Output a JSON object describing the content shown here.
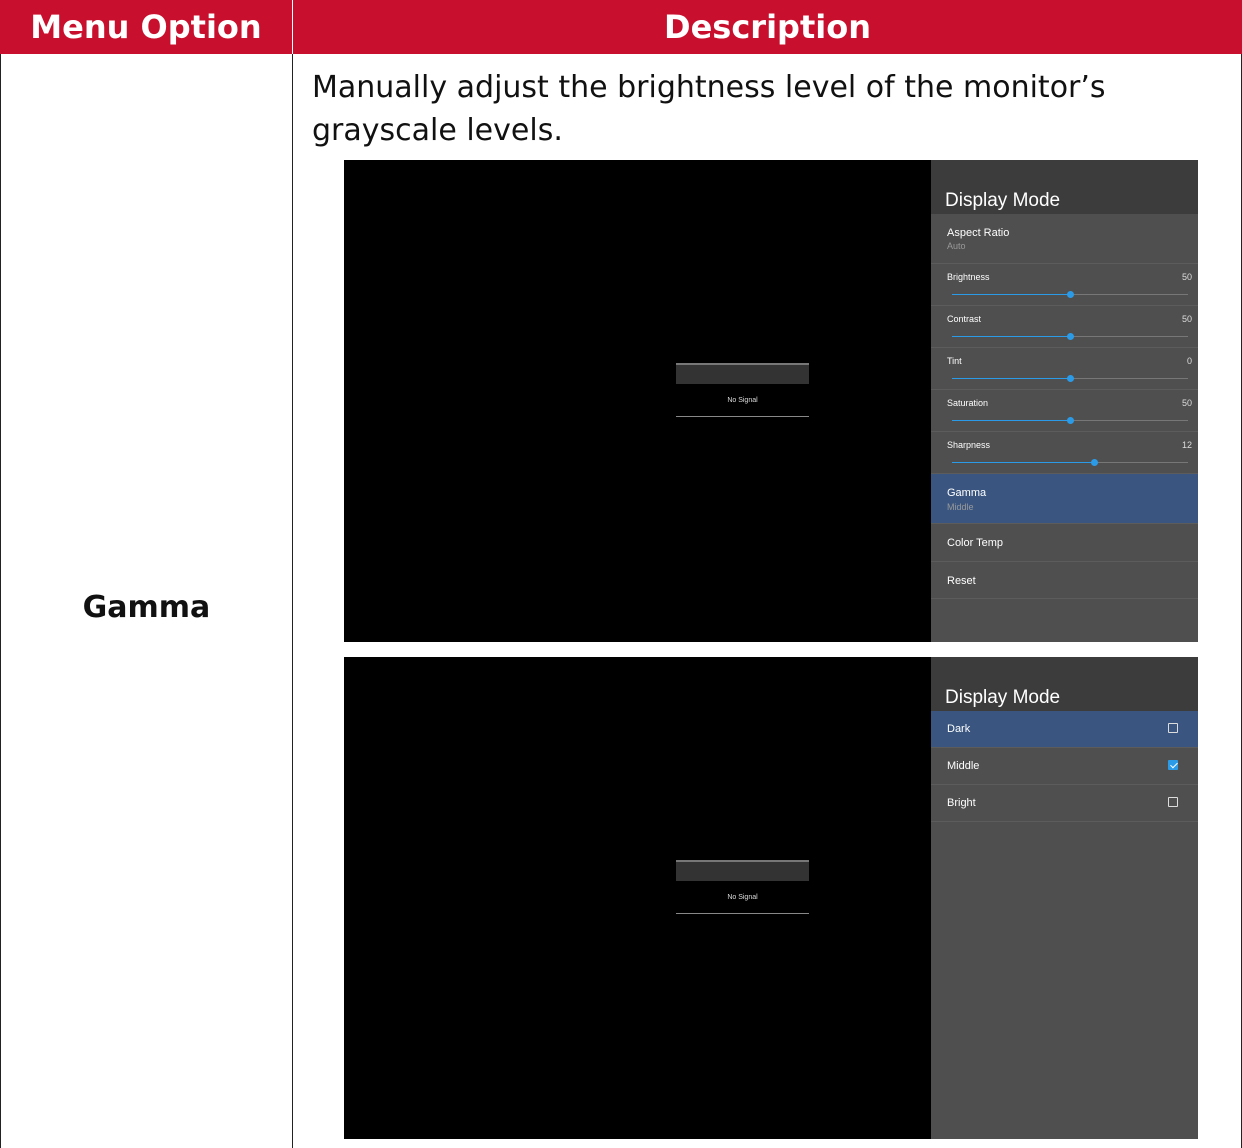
{
  "table": {
    "header": {
      "col1": "Menu Option",
      "col2": "Description"
    },
    "row": {
      "option": "Gamma",
      "description": "Manually adjust the brightness level of the monitor’s grayscale levels."
    }
  },
  "colors": {
    "header_bg": "#c8102e",
    "selected_bg": "#3a5680",
    "accent": "#2b9be8"
  },
  "screen1": {
    "no_signal": "No Signal",
    "panel_title": "Display Mode",
    "aspect_ratio": {
      "label": "Aspect Ratio",
      "value": "Auto"
    },
    "sliders": [
      {
        "label": "Brightness",
        "value": "50",
        "level": 0.5
      },
      {
        "label": "Contrast",
        "value": "50",
        "level": 0.5
      },
      {
        "label": "Tint",
        "value": "0",
        "level": 0.5
      },
      {
        "label": "Saturation",
        "value": "50",
        "level": 0.5
      },
      {
        "label": "Sharpness",
        "value": "12",
        "level": 0.6
      }
    ],
    "gamma": {
      "label": "Gamma",
      "value": "Middle"
    },
    "color_temp": "Color Temp",
    "reset": "Reset"
  },
  "screen2": {
    "no_signal": "No Signal",
    "panel_title": "Display Mode",
    "options": [
      {
        "label": "Dark",
        "checked": false,
        "selected": true
      },
      {
        "label": "Middle",
        "checked": true,
        "selected": false
      },
      {
        "label": "Bright",
        "checked": false,
        "selected": false
      }
    ]
  }
}
